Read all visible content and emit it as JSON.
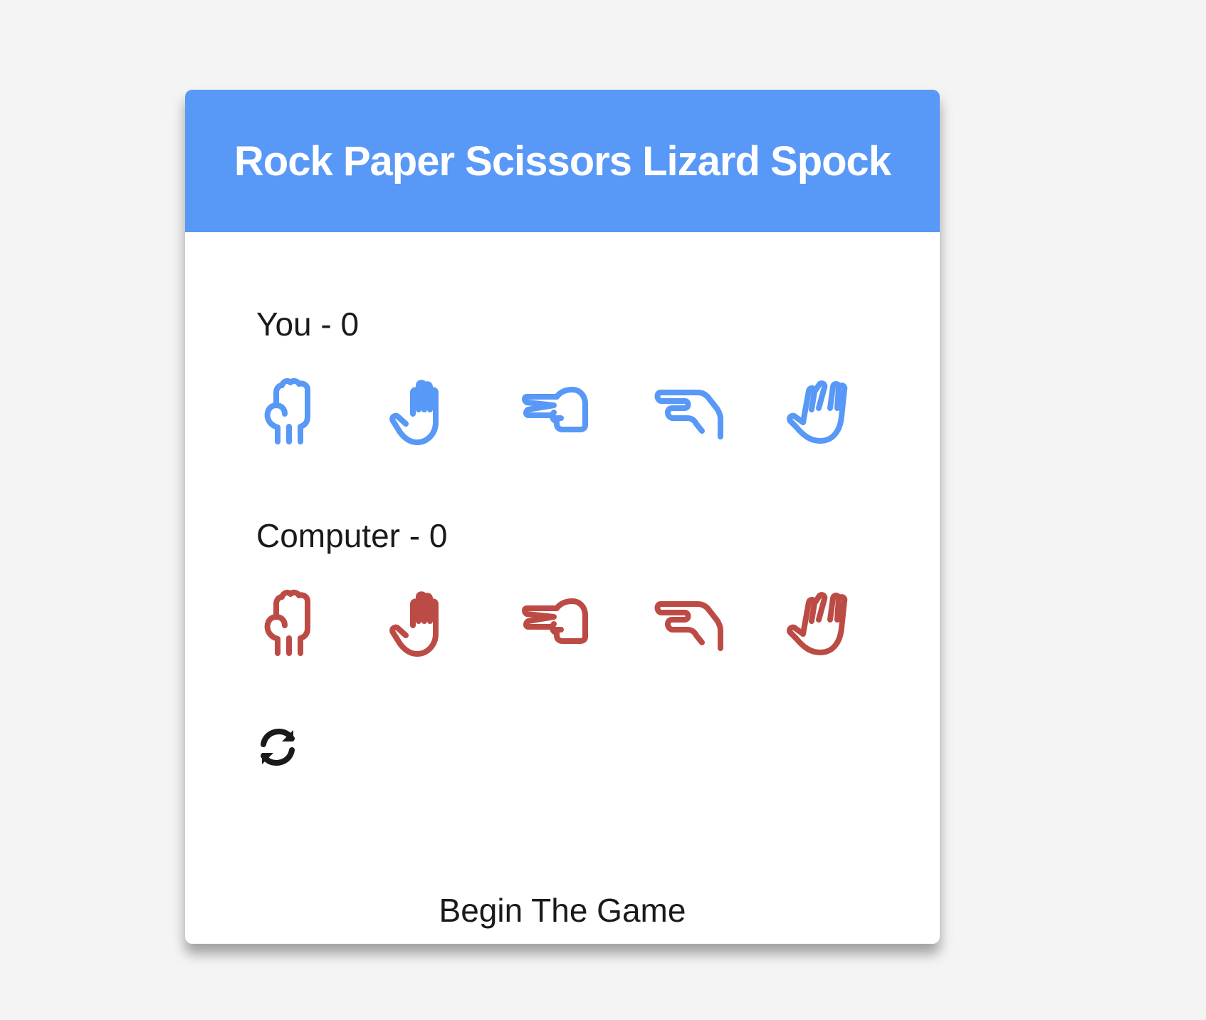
{
  "title": "Rock Paper Scissors Lizard Spock",
  "player": {
    "label": "You - 0"
  },
  "computer": {
    "label": "Computer - 0"
  },
  "choices": [
    "rock",
    "paper",
    "scissors",
    "lizard",
    "spock"
  ],
  "colors": {
    "header": "#5898f6",
    "player_icons": "#5898f6",
    "computer_icons": "#bd4b45"
  },
  "message": "Begin The Game",
  "reset_icon": "refresh-icon"
}
